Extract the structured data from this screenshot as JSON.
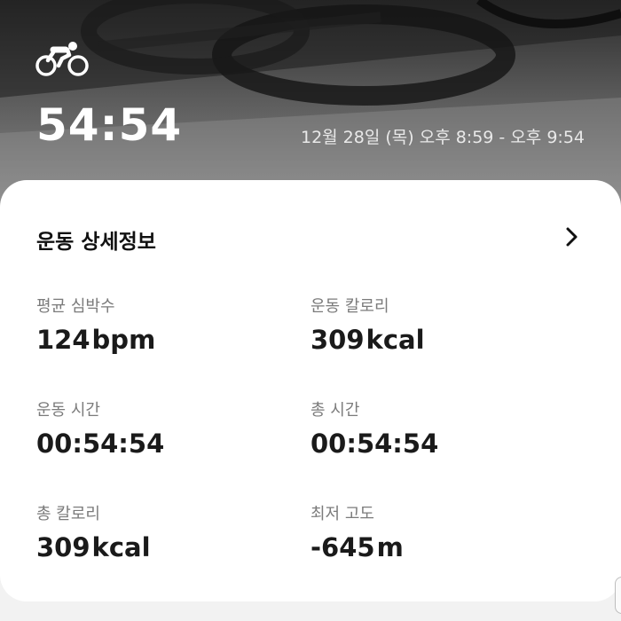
{
  "header": {
    "activity_icon": "cycling-icon",
    "duration": "54:54",
    "time_range": "12월 28일 (목) 오후 8:59 - 오후 9:54"
  },
  "details": {
    "title": "운동 상세정보",
    "chevron_icon": "chevron-right-icon",
    "metrics": [
      {
        "label": "평균 심박수",
        "value": "124",
        "unit": "bpm"
      },
      {
        "label": "운동 칼로리",
        "value": "309",
        "unit": "kcal"
      },
      {
        "label": "운동 시간",
        "value": "00:54:54",
        "unit": ""
      },
      {
        "label": "총 시간",
        "value": "00:54:54",
        "unit": ""
      },
      {
        "label": "총 칼로리",
        "value": "309",
        "unit": "kcal"
      },
      {
        "label": "최저 고도",
        "value": "-645",
        "unit": "m"
      }
    ]
  }
}
